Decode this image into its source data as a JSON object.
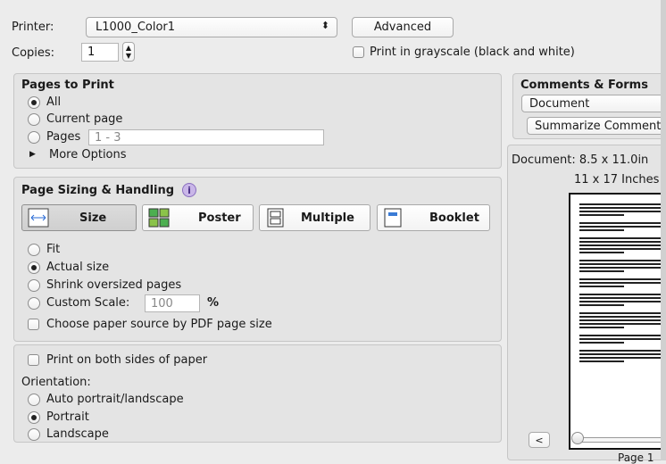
{
  "printer": {
    "label": "Printer:",
    "value": "L1000_Color1",
    "advanced_label": "Advanced"
  },
  "copies": {
    "label": "Copies:",
    "value": "1"
  },
  "grayscale_label": "Print in grayscale (black and white)",
  "pages": {
    "title": "Pages to Print",
    "all": "All",
    "current": "Current page",
    "pages": "Pages",
    "range_placeholder": "1 - 3",
    "more": "More Options"
  },
  "sizing": {
    "title": "Page Sizing & Handling",
    "tabs": [
      "Size",
      "Poster",
      "Multiple",
      "Booklet"
    ],
    "fit": "Fit",
    "actual": "Actual size",
    "shrink": "Shrink oversized pages",
    "custom": "Custom Scale:",
    "custom_value": "100",
    "percent": "%",
    "paper_source": "Choose paper source by PDF page size"
  },
  "sides_label": "Print on both sides of paper",
  "orientation": {
    "title": "Orientation:",
    "auto": "Auto portrait/landscape",
    "portrait": "Portrait",
    "landscape": "Landscape"
  },
  "comments": {
    "title": "Comments & Forms",
    "value": "Document",
    "summarize": "Summarize Comment"
  },
  "preview": {
    "doc_size": "Document: 8.5 x 11.0in",
    "paper_size": "11 x 17 Inches",
    "prev_label": "<",
    "page_label": "Page 1"
  },
  "colors": {
    "accent": "#1a1a1a",
    "panel": "#e4e4e4"
  }
}
